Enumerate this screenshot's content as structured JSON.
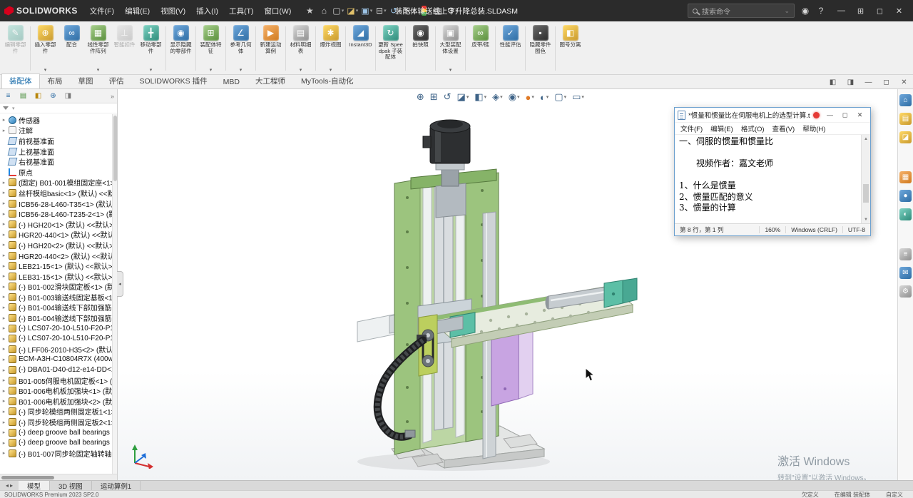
{
  "titlebar": {
    "app_name": "SOLIDWORKS",
    "menus": [
      "文件(F)",
      "编辑(E)",
      "视图(V)",
      "插入(I)",
      "工具(T)",
      "窗口(W)"
    ],
    "quick_icons": [
      "star",
      "home",
      "new-document",
      "open-folder",
      "save",
      "print",
      "undo",
      "select-arrow",
      "rebuild-traffic-light",
      "clipboard",
      "settings-gear"
    ],
    "document_title": "装配体输送线上下升降总装.SLDASM",
    "search_placeholder": "搜索命令",
    "right_icons": [
      "user-account",
      "help"
    ],
    "window_controls": [
      "minimize",
      "window-layout",
      "restore",
      "close"
    ]
  },
  "ribbon": {
    "buttons": [
      {
        "label": "编辑零部件",
        "icon": "edit-component",
        "disabled": true,
        "sep": true
      },
      {
        "label": "插入零部件",
        "icon": "insert-component",
        "dropdown": true
      },
      {
        "label": "配合",
        "icon": "mate"
      },
      {
        "label": "线性零部件阵列",
        "icon": "linear-component-pattern",
        "dropdown": true
      },
      {
        "label": "智能扣件",
        "icon": "smart-fasteners",
        "disabled": true
      },
      {
        "label": "移动零部件",
        "icon": "move-component",
        "dropdown": true,
        "sep": true
      },
      {
        "label": "显示隐藏的零部件",
        "icon": "show-hidden-components",
        "sep": true
      },
      {
        "label": "装配体特征",
        "icon": "assembly-features",
        "dropdown": true,
        "sep": true
      },
      {
        "label": "参考几何体",
        "icon": "reference-geometry",
        "dropdown": true,
        "sep": true
      },
      {
        "label": "新建运动算例",
        "icon": "new-motion-study",
        "sep": true
      },
      {
        "label": "材料明细表",
        "icon": "bill-of-materials",
        "dropdown": true,
        "sep": true
      },
      {
        "label": "爆炸视图",
        "icon": "exploded-view",
        "dropdown": true,
        "sep": true
      },
      {
        "label": "Instant3D",
        "icon": "instant3d",
        "sep": true
      },
      {
        "label": "更新 Speedpak 子装配体",
        "icon": "update-speedpak",
        "sep": true
      },
      {
        "label": "拍快照",
        "icon": "take-snapshot",
        "sep": true
      },
      {
        "label": "大型装配体设置",
        "icon": "large-assembly-settings",
        "dropdown": true,
        "sep": true
      },
      {
        "label": "皮带/链",
        "icon": "belt-chain",
        "sep": true
      },
      {
        "label": "性能评估",
        "icon": "performance-evaluation",
        "sep": true
      },
      {
        "label": "隐藏零件图色",
        "icon": "hide-component-color",
        "sep": true
      },
      {
        "label": "图号分离",
        "icon": "drawing-number-separate"
      }
    ]
  },
  "command_tabs": {
    "items": [
      "装配体",
      "布局",
      "草图",
      "评估",
      "SOLIDWORKS 插件",
      "MBD",
      "大工程师",
      "MyTools-自动化"
    ],
    "active": 0,
    "window_controls": [
      "pane-left",
      "pane-right",
      "doc-minimize",
      "doc-restore",
      "doc-close"
    ]
  },
  "feature_panel": {
    "toolbar_icons": [
      "featuremanager-tree",
      "propertymanager",
      "configuration-manager",
      "dimxpert-manager",
      "display-pane"
    ],
    "overflow": "»",
    "items": [
      {
        "icon": "sensors",
        "label": "传感器",
        "chevron": true
      },
      {
        "icon": "annotations",
        "label": "注解",
        "chevron": true
      },
      {
        "icon": "plane",
        "label": "前视基准面",
        "chevron": false
      },
      {
        "icon": "plane",
        "label": "上视基准面",
        "chevron": false
      },
      {
        "icon": "plane",
        "label": "右视基准面",
        "chevron": false
      },
      {
        "icon": "origin",
        "label": "原点",
        "chevron": false
      },
      {
        "icon": "part",
        "label": "(固定) B01-001模组固定座<1>",
        "chevron": true
      },
      {
        "icon": "part",
        "label": "丝杆模组basic<1> (默认) <<默认",
        "chevron": true
      },
      {
        "icon": "part",
        "label": "ICB56-28-L460-T35<1> (默认)",
        "chevron": true
      },
      {
        "icon": "part",
        "label": "ICB56-28-L460-T235-2<1> (默",
        "chevron": true
      },
      {
        "icon": "part",
        "label": "(-) HGH20<1> (默认) <<默认>_",
        "chevron": true
      },
      {
        "icon": "part",
        "label": "HGR20-440<1> (默认) <<默认>",
        "chevron": true
      },
      {
        "icon": "part",
        "label": "(-) HGH20<2> (默认) <<默认>",
        "chevron": true
      },
      {
        "icon": "part",
        "label": "HGR20-440<2> (默认) <<默认>",
        "chevron": true
      },
      {
        "icon": "part",
        "label": "LEB21-15<1> (默认) <<默认>_",
        "chevron": true
      },
      {
        "icon": "part",
        "label": "LEB31-15<1> (默认) <<默认>_",
        "chevron": true
      },
      {
        "icon": "part",
        "label": "(-) B01-002滑块固定板<1> (默认)",
        "chevron": true
      },
      {
        "icon": "part",
        "label": "(-) B01-003输送线固定基板<1>",
        "chevron": true
      },
      {
        "icon": "part",
        "label": "(-) B01-004输送线下部加强筋<1",
        "chevron": true
      },
      {
        "icon": "part",
        "label": "(-) B01-004输送线下部加强筋<2",
        "chevron": true
      },
      {
        "icon": "part",
        "label": "(-) LCS07-20-10-L510-F20-P12",
        "chevron": true
      },
      {
        "icon": "part",
        "label": "(-) LCS07-20-10-L510-F20-P12",
        "chevron": true
      },
      {
        "icon": "part",
        "label": "(-) LFF06-2010-H35<2> (默认)",
        "chevron": true
      },
      {
        "icon": "part",
        "label": "ECM-A3H-C10804R7X (400w...",
        "chevron": true
      },
      {
        "icon": "part",
        "label": "(-) DBA01-D40-d12-e14-DD<1",
        "chevron": true
      },
      {
        "icon": "part",
        "label": "B01-005伺服电机固定板<1> (默",
        "chevron": true
      },
      {
        "icon": "part",
        "label": "B01-006电机板加强块<1> (默认)",
        "chevron": true
      },
      {
        "icon": "part",
        "label": "B01-006电机板加强块<2> (默认)",
        "chevron": true
      },
      {
        "icon": "part",
        "label": "(-) 同步轮模组两侧固定板1<1>",
        "chevron": true
      },
      {
        "icon": "part",
        "label": "(-) 同步轮模组两侧固定板2<1>",
        "chevron": true
      },
      {
        "icon": "part",
        "label": "(-) deep groove ball bearings",
        "chevron": true
      },
      {
        "icon": "part",
        "label": "(-) deep groove ball bearings",
        "chevron": true
      },
      {
        "icon": "part",
        "label": "(-) B01-007同步轮固定轴转轴<1",
        "chevron": true
      }
    ]
  },
  "viewport": {
    "headsup": [
      {
        "name": "zoom-fit"
      },
      {
        "name": "zoom-area"
      },
      {
        "name": "previous-view"
      },
      {
        "name": "section-view",
        "dd": true
      },
      {
        "name": "view-orientation",
        "dd": true
      },
      {
        "name": "display-style",
        "dd": true
      },
      {
        "name": "hide-show-items",
        "dd": true
      },
      {
        "name": "edit-appearance",
        "dd": true
      },
      {
        "name": "apply-scene",
        "dd": true
      },
      {
        "name": "view-settings",
        "dd": true
      },
      {
        "name": "full-screen-monitor",
        "dd": true
      }
    ],
    "watermark_title": "激活 Windows",
    "watermark_sub": "转到\"设置\"以激活 Windows。"
  },
  "task_pane": {
    "icons": [
      {
        "name": "taskpane-home"
      },
      {
        "name": "design-library"
      },
      {
        "name": "file-explorer"
      },
      {
        "name": "view-palette",
        "gap": true
      },
      {
        "name": "appearances"
      },
      {
        "name": "scenes"
      },
      {
        "name": "custom-properties",
        "gap": true
      },
      {
        "name": "solidworks-forum"
      },
      {
        "name": "settings"
      }
    ]
  },
  "notepad": {
    "title": "*惯量和惯量比在伺服电机上的选型计算.txt -...",
    "menus": [
      "文件(F)",
      "编辑(E)",
      "格式(O)",
      "查看(V)",
      "帮助(H)"
    ],
    "lines": [
      "一、伺服的惯量和惯量比",
      "",
      "　　视频作者：嘉文老师",
      "",
      "1、什么是惯量",
      "2、惯量匹配的意义",
      "3、惯量的计算"
    ],
    "status": {
      "position": "第 8 行，第 1 列",
      "zoom": "160%",
      "eol": "Windows (CRLF)",
      "encoding": "UTF-8"
    },
    "window_controls": [
      "minimize",
      "maximize",
      "close"
    ]
  },
  "bottom": {
    "nav_icons": [
      "◂",
      "▸"
    ],
    "doc_tabs": [
      "模型",
      "3D 视图",
      "运动算例1"
    ],
    "active": 0,
    "status_left": "SOLIDWORKS Premium 2023 SP2.0",
    "status_right": [
      "欠定义",
      "在编辑 装配体",
      "自定义"
    ]
  }
}
